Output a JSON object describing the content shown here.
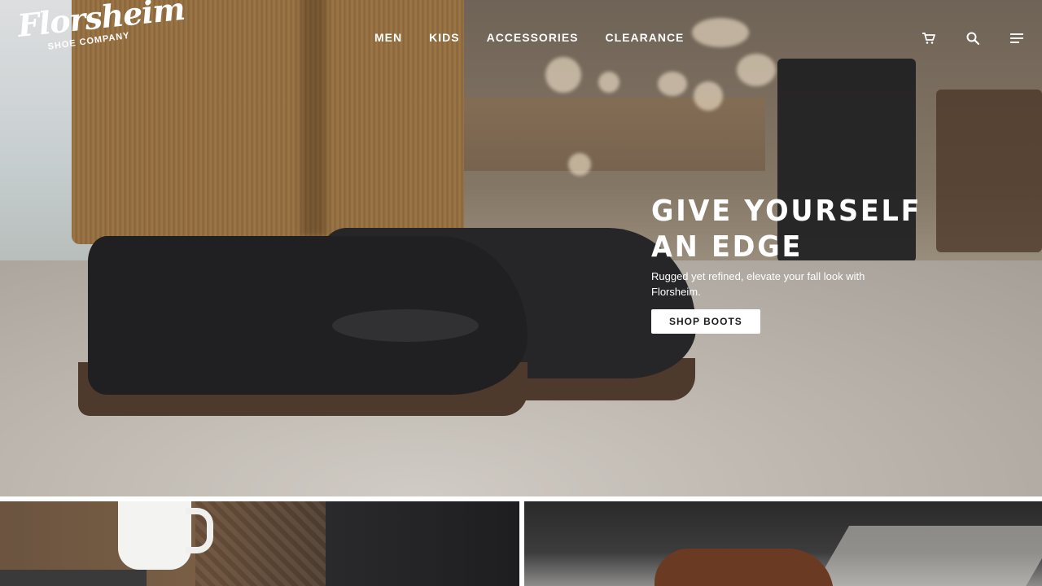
{
  "brand": {
    "name": "Florsheim",
    "tagline": "SHOE COMPANY"
  },
  "nav": {
    "items": [
      "MEN",
      "KIDS",
      "ACCESSORIES",
      "CLEARANCE"
    ]
  },
  "header_icons": [
    "cart-icon",
    "search-icon",
    "menu-icon"
  ],
  "hero": {
    "headline": "GIVE YOURSELF AN EDGE",
    "subtext": "Rugged yet refined, elevate your fall look with Florsheim.",
    "cta_label": "SHOP BOOTS"
  },
  "colors": {
    "text_on_image": "#ffffff",
    "cta_bg": "#ffffff",
    "cta_text": "#1d1d1d"
  }
}
